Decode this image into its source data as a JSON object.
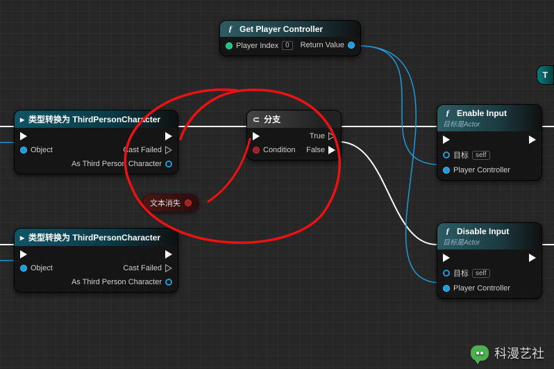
{
  "nodes": {
    "getPlayerController": {
      "title": "Get Player Controller",
      "pins": {
        "playerIndex": "Player Index",
        "playerIndexVal": "0",
        "returnValue": "Return Value"
      }
    },
    "cast1": {
      "title": "类型转换为 ThirdPersonCharacter",
      "pins": {
        "object": "Object",
        "castFailed": "Cast Failed",
        "asChar": "As Third Person Character"
      }
    },
    "cast2": {
      "title": "类型转换为 ThirdPersonCharacter",
      "pins": {
        "object": "Object",
        "castFailed": "Cast Failed",
        "asChar": "As Third Person Character"
      }
    },
    "branch": {
      "title": "分支",
      "pins": {
        "condition": "Condition",
        "trueLabel": "True",
        "falseLabel": "False"
      }
    },
    "enableInput": {
      "title": "Enable Input",
      "subtitle": "目标是Actor",
      "pins": {
        "target": "目标",
        "self": "self",
        "playerController": "Player Controller"
      }
    },
    "disableInput": {
      "title": "Disable Input",
      "subtitle": "目标是Actor",
      "pins": {
        "target": "目标",
        "self": "self",
        "playerController": "Player Controller"
      }
    },
    "varTextGone": {
      "label": "文本消失"
    },
    "tealClip": {
      "label": "T"
    }
  },
  "watermark": "科漫艺社"
}
